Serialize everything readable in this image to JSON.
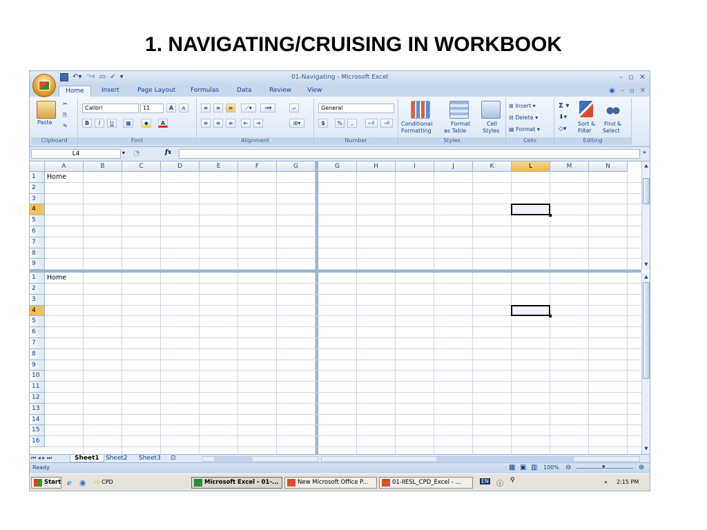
{
  "slide_title": "1. NAVIGATING/CRUISING IN WORKBOOK",
  "window": {
    "title": "01-Navigating - Microsoft Excel"
  },
  "tabs": [
    "Home",
    "Insert",
    "Page Layout",
    "Formulas",
    "Data",
    "Review",
    "View"
  ],
  "ribbon": {
    "clipboard": {
      "label": "Clipboard",
      "paste": "Paste"
    },
    "font": {
      "label": "Font",
      "name": "Calibri",
      "size": "11",
      "bold": "B",
      "italic": "I",
      "underline": "U",
      "grow": "A",
      "shrink": "A",
      "color_letter": "A"
    },
    "alignment": {
      "label": "Alignment"
    },
    "number": {
      "label": "Number",
      "format": "General",
      "currency": "$",
      "percent": "%",
      "comma": ","
    },
    "styles": {
      "label": "Styles",
      "conditional_1": "Conditional",
      "conditional_2": "Formatting",
      "format_table_1": "Format",
      "format_table_2": "as Table",
      "cell_styles_1": "Cell",
      "cell_styles_2": "Styles"
    },
    "cells": {
      "label": "Cells",
      "insert": "Insert",
      "delete": "Delete",
      "format": "Format"
    },
    "editing": {
      "label": "Editing",
      "sort_1": "Sort &",
      "sort_2": "Filter",
      "find_1": "Find &",
      "find_2": "Select",
      "sigma": "Σ"
    }
  },
  "formula_bar": {
    "name_box": "L4",
    "fx": "fx",
    "value": ""
  },
  "grid": {
    "left_columns": [
      "A",
      "B",
      "C",
      "D",
      "E",
      "F",
      "G"
    ],
    "right_columns": [
      "G",
      "H",
      "I",
      "J",
      "K",
      "L",
      "M",
      "N"
    ],
    "selected_column": "L",
    "selected_row": "4",
    "top_rows": [
      "1",
      "2",
      "3",
      "4",
      "5",
      "6",
      "7",
      "8",
      "9"
    ],
    "bottom_rows": [
      "1",
      "2",
      "3",
      "4",
      "5",
      "6",
      "7",
      "8",
      "9",
      "10",
      "11",
      "12",
      "13",
      "14",
      "15",
      "16"
    ],
    "cell_a1": "Home"
  },
  "sheets": [
    "Sheet1",
    "Sheet2",
    "Sheet3"
  ],
  "status": {
    "ready": "Ready",
    "zoom": "100%"
  },
  "taskbar": {
    "start": "Start",
    "cpd": "CPD",
    "excel": "Microsoft Excel - 01-...",
    "office": "New Microsoft Office P...",
    "iiesl": "01-IIESL_CPD_Excel - ...",
    "lang": "EN",
    "time": "2:15 PM"
  }
}
